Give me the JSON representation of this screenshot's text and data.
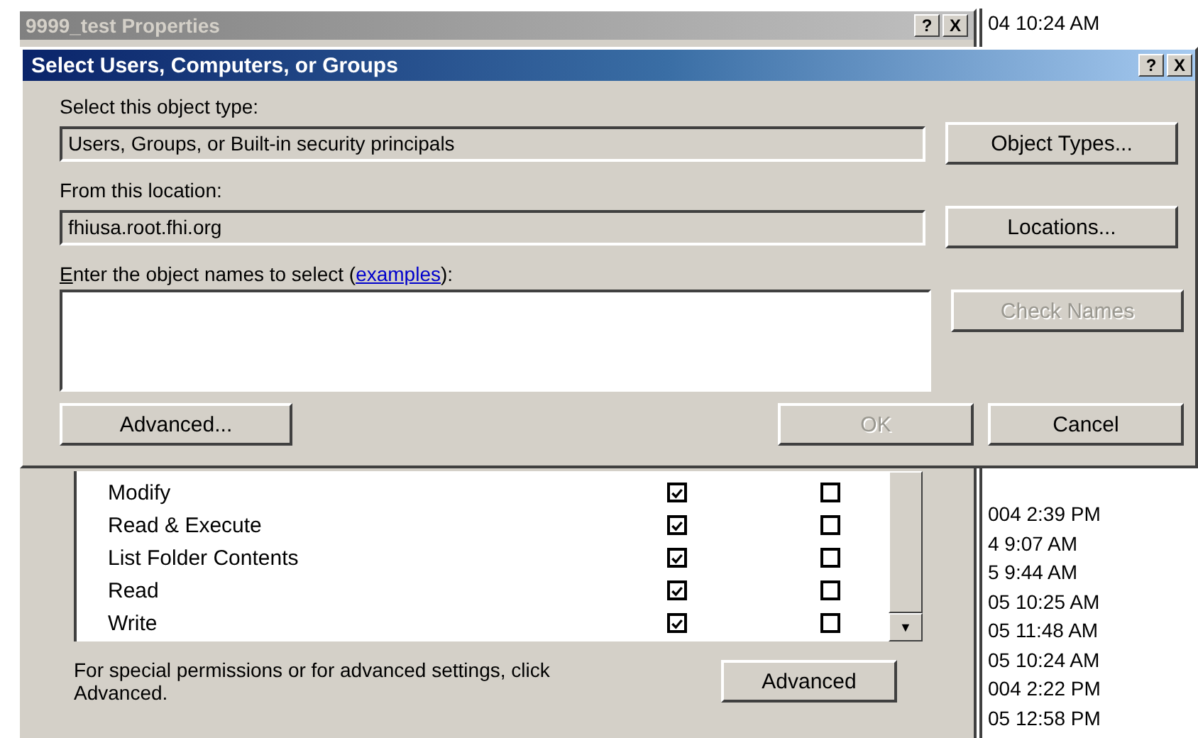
{
  "back_window": {
    "title": "9999_test Properties",
    "help_button": "?",
    "close_button": "X",
    "permissions": [
      {
        "name": "Modify",
        "allow": true,
        "deny": false
      },
      {
        "name": "Read & Execute",
        "allow": true,
        "deny": false
      },
      {
        "name": "List Folder Contents",
        "allow": true,
        "deny": false
      },
      {
        "name": "Read",
        "allow": true,
        "deny": false
      },
      {
        "name": "Write",
        "allow": true,
        "deny": false
      }
    ],
    "scroll_down": "▼",
    "hint": "For special permissions or for advanced settings, click Advanced.",
    "advanced_button": "Advanced"
  },
  "times": {
    "top": "04 10:24 AM",
    "items": [
      "004 2:39 PM",
      "4 9:07 AM",
      "5 9:44 AM",
      "05 10:25 AM",
      "05 11:48 AM",
      "05 10:24 AM",
      "004 2:22 PM",
      "05 12:58 PM"
    ]
  },
  "dialog": {
    "title": "Select Users, Computers, or Groups",
    "help_button": "?",
    "close_button": "X",
    "object_type_label": "Select this object type:",
    "object_type": "Users, Groups, or Built-in security principals",
    "object_types_button": "Object Types...",
    "location_label": "From this location:",
    "location": "fhiusa.root.fhi.org",
    "locations_button": "Locations...",
    "names_label": {
      "before": "Enter the object names to select (",
      "link": "examples",
      "after": "):"
    },
    "check_names": {
      "label": "Check Names",
      "disabled": true
    },
    "advanced_button": "Advanced...",
    "ok": {
      "label": "OK",
      "disabled": true
    },
    "cancel": {
      "label": "Cancel",
      "disabled": false
    }
  }
}
